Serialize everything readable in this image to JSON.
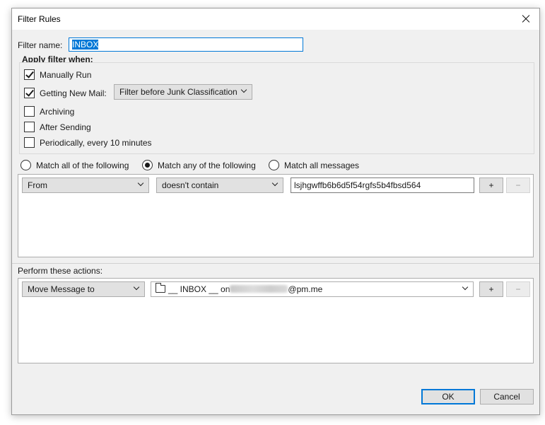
{
  "window": {
    "title": "Filter Rules"
  },
  "filter_name": {
    "label": "Filter name:",
    "value": "INBOX"
  },
  "apply_when": {
    "heading": "Apply filter when:",
    "options": [
      {
        "label": "Manually Run",
        "checked": true
      },
      {
        "label": "Getting New Mail:",
        "checked": true
      },
      {
        "label": "Archiving",
        "checked": false
      },
      {
        "label": "After Sending",
        "checked": false
      },
      {
        "label": "Periodically, every 10 minutes",
        "checked": false
      }
    ],
    "new_mail_timing": "Filter before Junk Classification"
  },
  "match": {
    "options": [
      {
        "label": "Match all of the following",
        "selected": false
      },
      {
        "label": "Match any of the following",
        "selected": true
      },
      {
        "label": "Match all messages",
        "selected": false
      }
    ]
  },
  "rule": {
    "field": "From",
    "operator": "doesn't contain",
    "value": "lsjhgwffb6b6d5f54rgfs5b4fbsd564",
    "add_label": "+",
    "remove_label": "−"
  },
  "actions": {
    "heading": "Perform these actions:",
    "action": "Move Message to",
    "folder_prefix": "__ INBOX __ on",
    "folder_suffix": "@pm.me",
    "add_label": "+",
    "remove_label": "−"
  },
  "buttons": {
    "ok": "OK",
    "cancel": "Cancel"
  },
  "icons": {
    "close": "close-icon",
    "folder": "folder-icon",
    "dropdown": "chevron-down-icon"
  },
  "colors": {
    "accent": "#0078d7",
    "dialog_bg": "#f0f0f0"
  }
}
